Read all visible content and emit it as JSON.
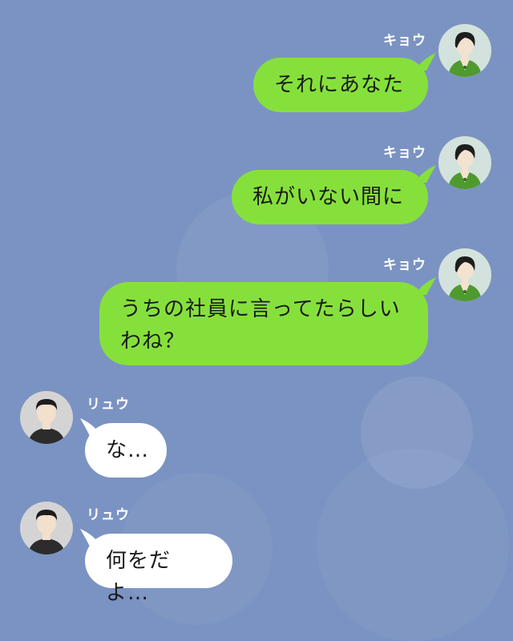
{
  "colors": {
    "background": "#7b93c2",
    "sent_bubble": "#86e03c",
    "received_bubble": "#ffffff",
    "name_text": "#ffffff"
  },
  "messages": [
    {
      "sender": "キョウ",
      "direction": "sent",
      "text": "それにあなた",
      "avatar": "woman-avatar"
    },
    {
      "sender": "キョウ",
      "direction": "sent",
      "text": "私がいない間に",
      "avatar": "woman-avatar"
    },
    {
      "sender": "キョウ",
      "direction": "sent",
      "text": "うちの社員に言ってたらしいわね？",
      "avatar": "woman-avatar"
    },
    {
      "sender": "リュウ",
      "direction": "received",
      "text": "な…",
      "avatar": "man-avatar"
    },
    {
      "sender": "リュウ",
      "direction": "received",
      "text": "何をだよ…",
      "avatar": "man-avatar"
    }
  ]
}
